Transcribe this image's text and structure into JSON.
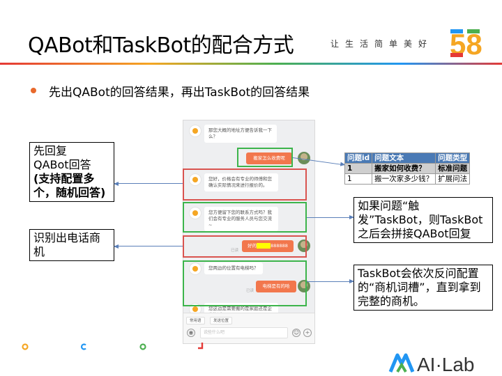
{
  "header": {
    "title": "QABot和TaskBot的配合方式",
    "slogan": "让生活简单美好",
    "logo_text": "58",
    "colors": {
      "red": "#e53935",
      "orange": "#f5a623",
      "green": "#4caf50",
      "blue": "#2196f3"
    }
  },
  "bullet": {
    "text": "先出QABot的回答结果，再出TaskBot的回答结果"
  },
  "phone": {
    "messages": [
      {
        "side": "left",
        "text": "那您大概的地址方便告诉我一下么？"
      },
      {
        "side": "right",
        "text": "搬家怎么收费呢"
      },
      {
        "side": "left",
        "text": "您好，价格会有专业的师傅和您确认实际情况来进行报价的。"
      },
      {
        "side": "left",
        "text": "您方便留下您的联系方式吗？我们会有专业的服务人员与您交流~"
      },
      {
        "side": "right",
        "text_prefix": "好的",
        "text_suffix": "888888"
      },
      {
        "side": "left",
        "text": "您两边的位置有电梯吗？"
      },
      {
        "side": "right",
        "text": "电梯是有的哈"
      },
      {
        "side": "left",
        "text": "您这边是需要搬的是家庭还是企业搬迁呢？"
      }
    ],
    "read_label": "已读",
    "quick_chips": [
      "常用语",
      "发送位置"
    ],
    "input_placeholder": "说些什么吧"
  },
  "callouts": {
    "reply_line1": "先回复",
    "reply_line2": "QABot回答",
    "reply_bold": "(支持配置多个，随机回答)",
    "phone_detect": "识别出电话商机",
    "trigger": "如果问题“触发”TaskBot，则TaskBot之后会拼接QABot回复",
    "taskbot": "TaskBot会依次反问配置的“商机词槽”，直到拿到完整的商机。"
  },
  "qa_table": {
    "headers": [
      "问题id",
      "问题文本",
      "问题类型"
    ],
    "rows": [
      [
        "1",
        "搬家如何收费？",
        "标准问题"
      ],
      [
        "1",
        "搬一次家多少钱？",
        "扩展问法"
      ]
    ]
  },
  "footer": {
    "brand": "AI·Lab"
  }
}
